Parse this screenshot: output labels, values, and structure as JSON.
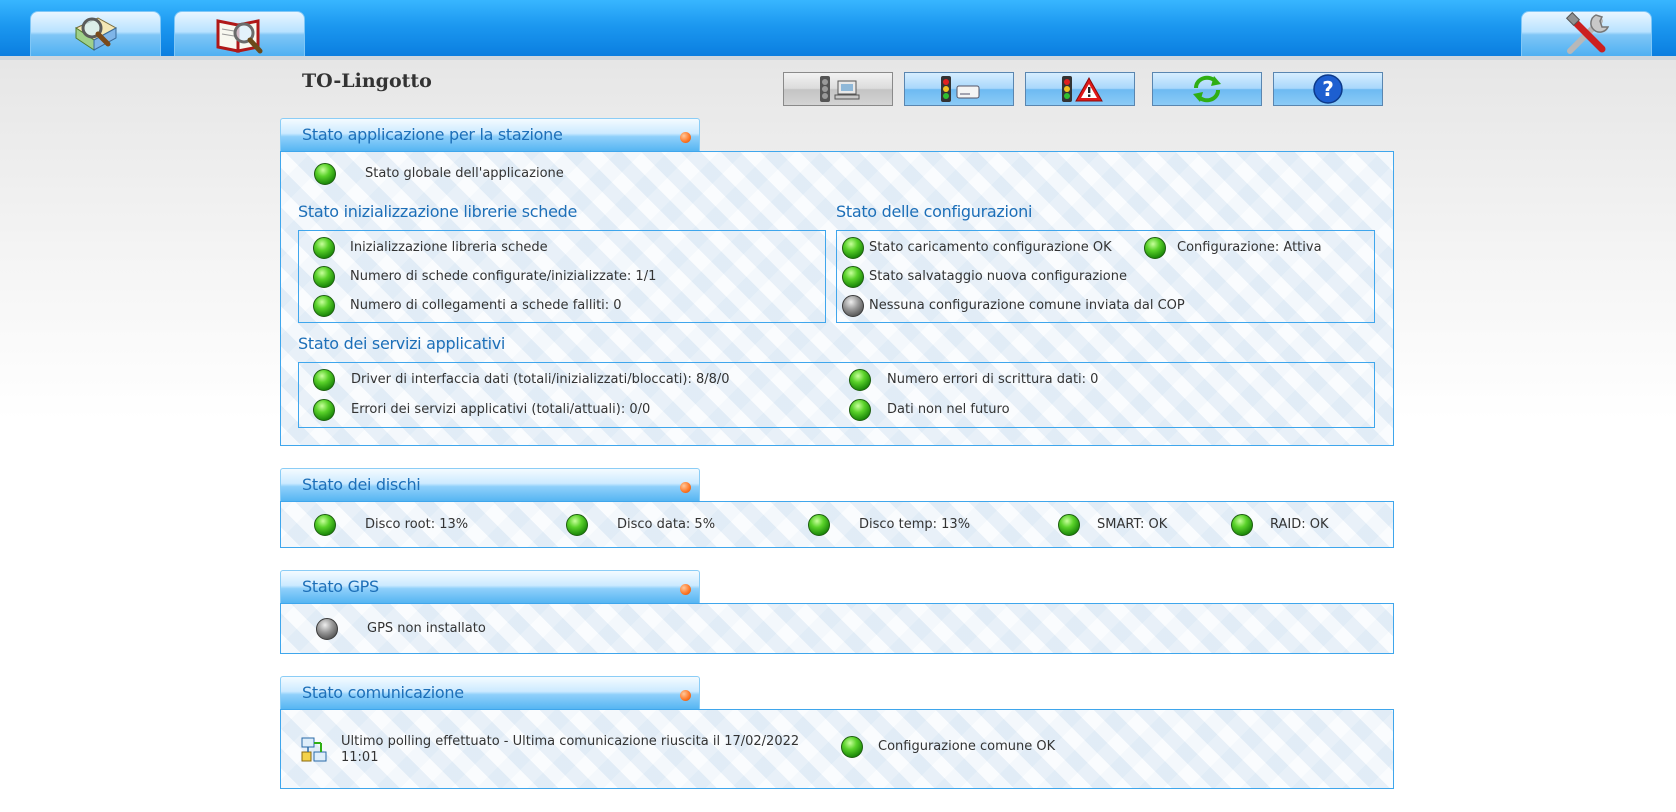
{
  "header": {
    "station": "TO-Lingotto",
    "nav": [
      {
        "icon": "map-search-icon"
      },
      {
        "icon": "book-search-icon"
      }
    ],
    "settings_icon": "tools-icon",
    "toolbar": [
      {
        "icon": "traffic-light-computer-icon",
        "style": "grey"
      },
      {
        "icon": "traffic-light-disk-icon",
        "style": "blue"
      },
      {
        "icon": "traffic-light-warning-icon",
        "style": "blue"
      },
      {
        "icon": "refresh-icon",
        "style": "blue"
      },
      {
        "icon": "help-icon",
        "style": "blue"
      }
    ]
  },
  "app": {
    "title": "Stato applicazione per la stazione",
    "global": {
      "label": "Stato globale dell'applicazione",
      "status": "green"
    },
    "libs": {
      "title": "Stato inizializzazione librerie schede",
      "items": [
        {
          "label": "Inizializzazione libreria schede",
          "status": "green"
        },
        {
          "label": "Numero di schede configurate/inizializzate: 1/1",
          "status": "green"
        },
        {
          "label": "Numero di collegamenti a schede falliti: 0",
          "status": "green"
        }
      ]
    },
    "config": {
      "title": "Stato delle configurazioni",
      "items": [
        {
          "label": "Stato caricamento configurazione OK",
          "status": "green"
        },
        {
          "label": "Configurazione: Attiva",
          "status": "green"
        },
        {
          "label": "Stato salvataggio nuova configurazione",
          "status": "green"
        },
        {
          "label": "Nessuna configurazione comune inviata dal COP",
          "status": "grey"
        }
      ]
    },
    "services": {
      "title": "Stato dei servizi applicativi",
      "items": [
        {
          "label": "Driver di interfaccia dati (totali/inizializzati/bloccati): 8/8/0",
          "status": "green"
        },
        {
          "label": "Numero errori di scrittura dati: 0",
          "status": "green"
        },
        {
          "label": "Errori dei servizi applicativi (totali/attuali): 0/0",
          "status": "green"
        },
        {
          "label": "Dati non nel futuro",
          "status": "green"
        }
      ]
    }
  },
  "disks": {
    "title": "Stato dei dischi",
    "items": [
      {
        "label": "Disco root: 13%",
        "status": "green"
      },
      {
        "label": "Disco data: 5%",
        "status": "green"
      },
      {
        "label": "Disco temp: 13%",
        "status": "green"
      },
      {
        "label": "SMART: OK",
        "status": "green"
      },
      {
        "label": "RAID: OK",
        "status": "green"
      }
    ]
  },
  "gps": {
    "title": "Stato GPS",
    "items": [
      {
        "label": "GPS non installato",
        "status": "grey"
      }
    ]
  },
  "comm": {
    "title": "Stato comunicazione",
    "polling_icon": "network-icon",
    "polling_line1": "Ultimo polling effettuato - Ultima comunicazione riuscita il 17/02/2022",
    "polling_line2": "11:01",
    "config": {
      "label": "Configurazione comune OK",
      "status": "green"
    }
  },
  "colors": {
    "accent": "#1d6fb8",
    "topbar": "#1c98f0",
    "border": "#3fa6ec",
    "status_ok": "#2fae14",
    "status_off": "#777777",
    "section_dot": "#ff7a2a"
  }
}
